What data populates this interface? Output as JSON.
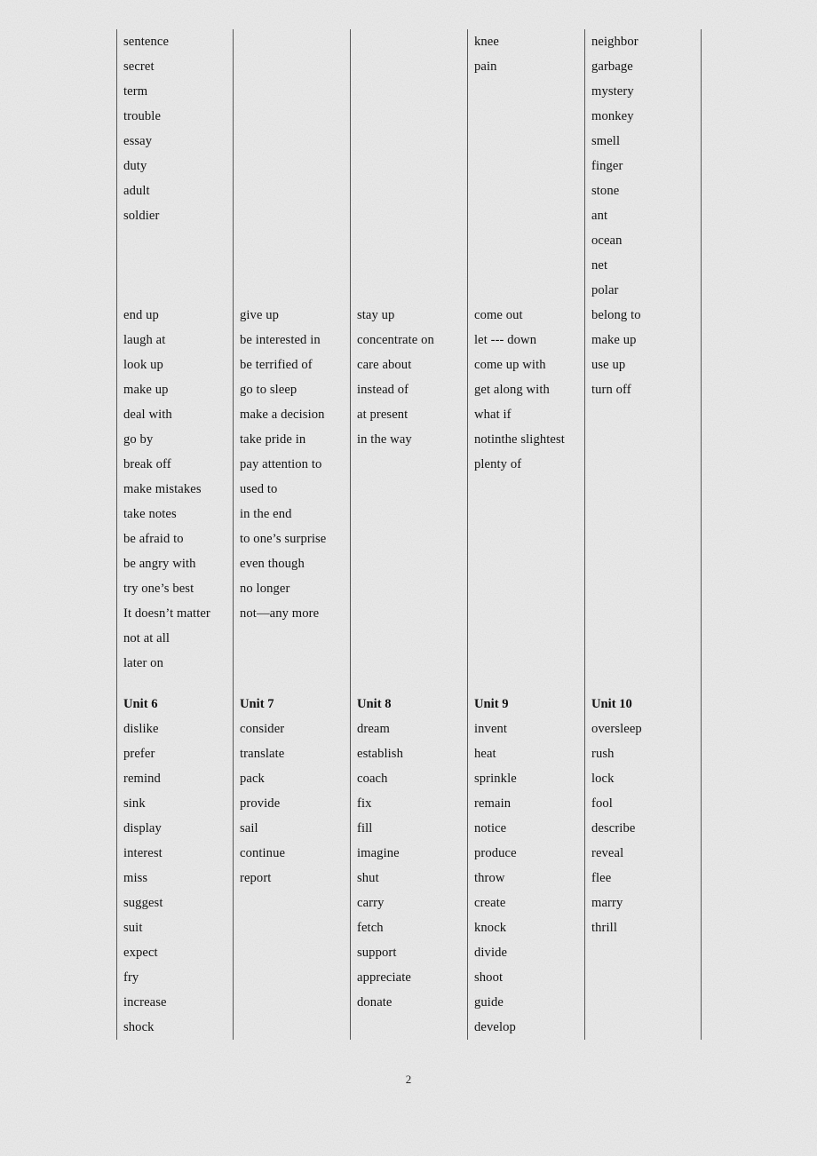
{
  "page": {
    "number": "2",
    "background_color": "#ededed",
    "text_color": "#111111",
    "border_color": "#5a5a5a"
  },
  "table": {
    "columns": 5,
    "rows": [
      {
        "name": "nouns-continued",
        "type": "data",
        "cells": [
          [
            "sentence",
            "secret",
            "term",
            "trouble",
            "essay",
            "duty",
            "adult",
            "soldier"
          ],
          [],
          [],
          [
            "knee",
            "pain"
          ],
          [
            "neighbor",
            "garbage",
            "mystery",
            "monkey",
            "smell",
            "finger",
            "stone",
            "ant",
            "ocean",
            "net",
            "polar"
          ]
        ]
      },
      {
        "name": "phrases",
        "type": "data",
        "cells": [
          [
            "end up",
            "laugh at",
            "look up",
            "make up",
            "deal with",
            "go by",
            "break off",
            "make mistakes",
            "take notes",
            "be afraid to",
            "be angry with",
            "try one’s best",
            "It doesn’t matter",
            "not at all",
            "later on"
          ],
          [
            "give up",
            "be interested in",
            "be terrified of",
            "go to sleep",
            "make a decision",
            "take pride in",
            "pay attention to",
            "used to",
            "in the end",
            "to one’s surprise",
            "even though",
            "no longer",
            "not—any more"
          ],
          [
            "stay up",
            "concentrate on",
            "care about",
            "instead of",
            "at present",
            "in the way"
          ],
          [
            "come out",
            "let --- down",
            "come up with",
            "get along with",
            "what if",
            "notinthe slightest",
            "plenty of"
          ],
          [
            "belong to",
            "make up",
            "use up",
            "turn off"
          ]
        ]
      },
      {
        "name": "unit-headers",
        "type": "header",
        "cells": [
          [
            "Unit 6"
          ],
          [
            "Unit 7"
          ],
          [
            "Unit 8"
          ],
          [
            "Unit 9"
          ],
          [
            "Unit 10"
          ]
        ]
      },
      {
        "name": "verbs",
        "type": "data",
        "cells": [
          [
            "dislike",
            "prefer",
            "remind",
            "sink",
            "display",
            "interest",
            "miss",
            "suggest",
            "suit",
            "expect",
            "fry",
            "increase",
            "shock"
          ],
          [
            "consider",
            "translate",
            "pack",
            "provide",
            "sail",
            "continue",
            "report"
          ],
          [
            "dream",
            "establish",
            "coach",
            "fix",
            "fill",
            "imagine",
            "shut",
            "carry",
            "fetch",
            "support",
            "appreciate",
            "donate"
          ],
          [
            "invent",
            "heat",
            "sprinkle",
            "remain",
            "notice",
            "produce",
            "throw",
            "create",
            "knock",
            "divide",
            "shoot",
            "guide",
            "develop"
          ],
          [
            "oversleep",
            "rush",
            "lock",
            "fool",
            "describe",
            "reveal",
            "flee",
            "marry",
            "thrill"
          ]
        ]
      }
    ]
  }
}
